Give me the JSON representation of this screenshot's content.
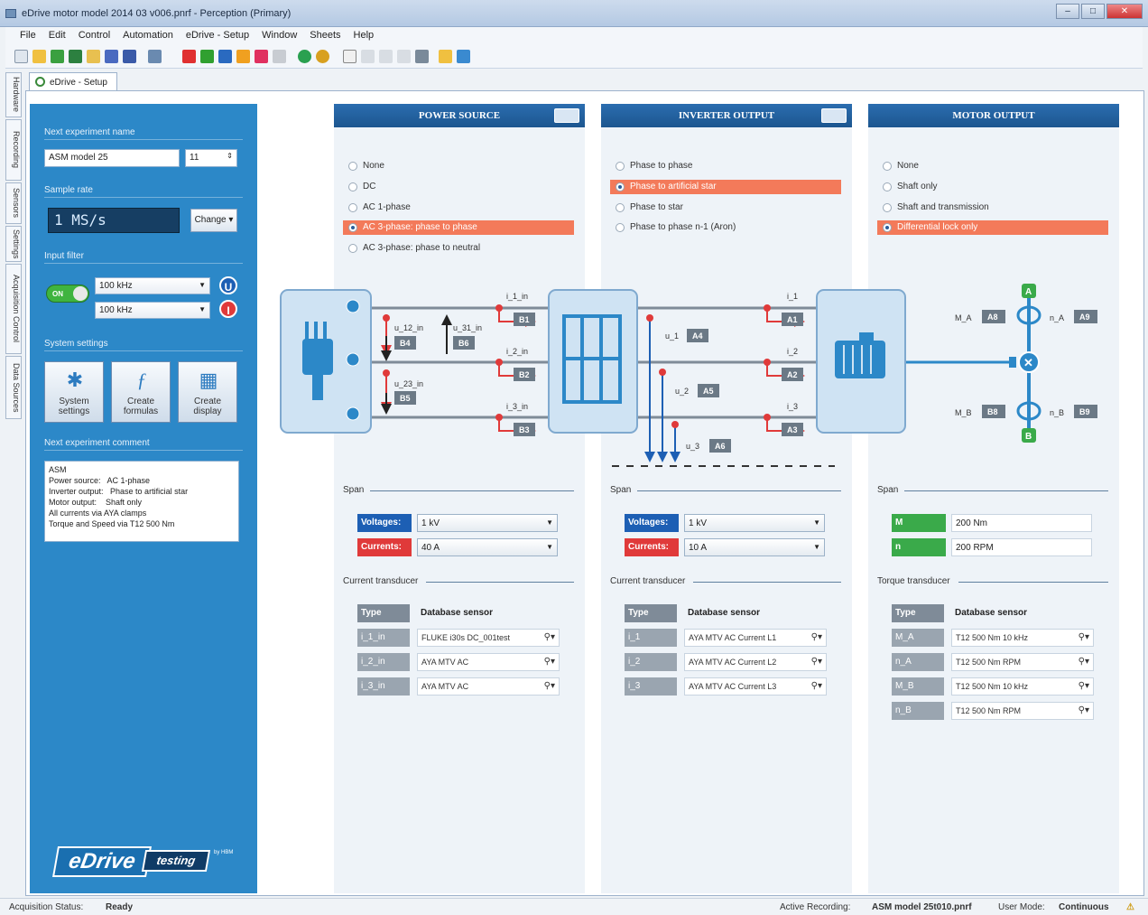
{
  "window": {
    "title": "eDrive motor model 2014 03 v006.pnrf - Perception (Primary)"
  },
  "menu": [
    "File",
    "Edit",
    "Control",
    "Automation",
    "eDrive - Setup",
    "Window",
    "Sheets",
    "Help"
  ],
  "side_tabs": [
    "Hardware",
    "Recording",
    "Sensors",
    "Settings",
    "Acquisition Control",
    "Data Sources"
  ],
  "doc_tab": "eDrive - Setup",
  "left": {
    "next_name_label": "Next experiment name",
    "name_value": "ASM model 25",
    "name_index": "11",
    "sample_rate_label": "Sample rate",
    "sample_rate": "1 MS/s",
    "change_btn": "Change",
    "input_filter_label": "Input filter",
    "toggle": "ON",
    "filter1": "100 kHz",
    "filter2": "100 kHz",
    "u_label": "U",
    "i_label": "I",
    "system_settings_label": "System settings",
    "btn_system": [
      "System",
      "settings"
    ],
    "btn_formulas": [
      "Create",
      "formulas"
    ],
    "btn_display": [
      "Create",
      "display"
    ],
    "comment_label": "Next experiment comment",
    "comment": "ASM\nPower source:   AC 1-phase\nInverter output:   Phase to artificial star\nMotor output:    Shaft only\nAll currents via AYA clamps\nTorque and Speed via T12 500 Nm",
    "logo_edrive": "eDrive",
    "logo_testing": "testing",
    "logo_by": "by HBM"
  },
  "power": {
    "title": "POWER SOURCE",
    "options": [
      "None",
      "DC",
      "AC 1-phase",
      "AC 3-phase: phase to phase",
      "AC 3-phase: phase to neutral"
    ],
    "selected": 3,
    "span_label": "Span",
    "voltages_label": "Voltages:",
    "voltage": "1 kV",
    "currents_label": "Currents:",
    "current": "40 A",
    "transducer_label": "Current transducer",
    "type_hdr": "Type",
    "db_hdr": "Database sensor",
    "rows": [
      [
        "i_1_in",
        "FLUKE i30s  DC_001test"
      ],
      [
        "i_2_in",
        "AYA MTV  AC"
      ],
      [
        "i_3_in",
        "AYA MTV  AC"
      ]
    ]
  },
  "inverter": {
    "title": "INVERTER OUTPUT",
    "options": [
      "Phase to phase",
      "Phase to artificial star",
      "Phase to star",
      "Phase to phase n-1 (Aron)"
    ],
    "selected": 1,
    "span_label": "Span",
    "voltages_label": "Voltages:",
    "voltage": "1 kV",
    "currents_label": "Currents:",
    "current": "10 A",
    "transducer_label": "Current transducer",
    "type_hdr": "Type",
    "db_hdr": "Database sensor",
    "rows": [
      [
        "i_1",
        "AYA MTV  AC Current L1"
      ],
      [
        "i_2",
        "AYA MTV  AC Current L2"
      ],
      [
        "i_3",
        "AYA MTV  AC Current L3"
      ]
    ]
  },
  "motor": {
    "title": "MOTOR OUTPUT",
    "options": [
      "None",
      "Shaft only",
      "Shaft and transmission",
      "Differential lock only"
    ],
    "selected": 3,
    "span_label": "Span",
    "m_label": "M",
    "m_value": "200 Nm",
    "n_label": "n",
    "n_value": "200 RPM",
    "transducer_label": "Torque transducer",
    "type_hdr": "Type",
    "db_hdr": "Database sensor",
    "rows": [
      [
        "M_A",
        "T12 500 Nm 10 kHz"
      ],
      [
        "n_A",
        "T12 500 Nm RPM"
      ],
      [
        "M_B",
        "T12 500 Nm 10 kHz"
      ],
      [
        "n_B",
        "T12 500 Nm RPM"
      ]
    ]
  },
  "diagram": {
    "power_labels": {
      "i1": "i_1_in",
      "i2": "i_2_in",
      "i3": "i_3_in",
      "u12": "u_12_in",
      "u31": "u_31_in",
      "u23": "u_23_in",
      "b1": "B1",
      "b2": "B2",
      "b3": "B3",
      "b4": "B4",
      "b5": "B5",
      "b6": "B6"
    },
    "inverter_labels": {
      "i1": "i_1",
      "i2": "i_2",
      "i3": "i_3",
      "u1": "u_1",
      "u2": "u_2",
      "u3": "u_3",
      "a1": "A1",
      "a2": "A2",
      "a3": "A3",
      "a4": "A4",
      "a5": "A5",
      "a6": "A6"
    },
    "motor_labels": {
      "ma": "M_A",
      "na": "n_A",
      "mb": "M_B",
      "nb": "n_B",
      "a8": "A8",
      "a9": "A9",
      "b8": "B8",
      "b9": "B9",
      "A": "A",
      "B": "B"
    }
  },
  "status": {
    "acq_label": "Acquisition Status:",
    "acq_value": "Ready",
    "rec_label": "Active Recording:",
    "rec_value": "ASM model 25t010.pnrf",
    "mode_label": "User Mode:",
    "mode_value": "Continuous"
  },
  "colors": {
    "blue_panel": "#2c88c8",
    "header": "#1c568f",
    "selected": "#f37a5a",
    "voltage": "#1d5fb4",
    "current": "#e03a3a"
  }
}
